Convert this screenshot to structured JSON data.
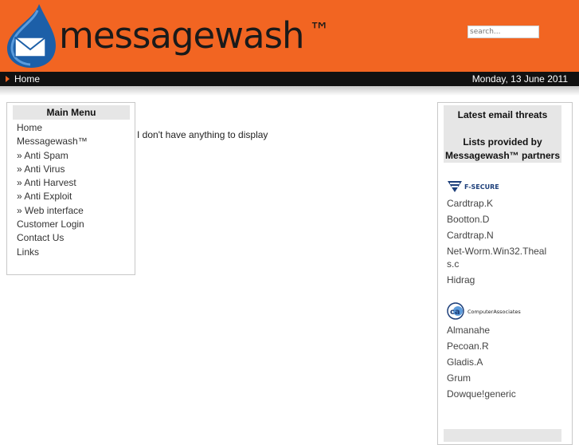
{
  "header": {
    "brand_name": "messagewash",
    "trademark": "™",
    "search_placeholder": "search...",
    "brand_color": "#f26522"
  },
  "navbar": {
    "home_label": "Home",
    "date": "Monday, 13 June 2011"
  },
  "main_menu": {
    "title": "Main Menu",
    "items": [
      {
        "label": "Home"
      },
      {
        "label": "Messagewash™"
      },
      {
        "label": "» Anti Spam"
      },
      {
        "label": "» Anti Virus"
      },
      {
        "label": "» Anti Harvest"
      },
      {
        "label": "» Anti Exploit"
      },
      {
        "label": "» Web interface"
      },
      {
        "label": "Customer Login"
      },
      {
        "label": "Contact Us"
      },
      {
        "label": "Links"
      }
    ]
  },
  "content": {
    "message": "I don't have anything to display"
  },
  "threats": {
    "title": "Latest email threats",
    "subtitle": "Lists provided by Messagewash™ partners",
    "fsecure": {
      "logo_text": "F-SECURE",
      "items": [
        "Cardtrap.K",
        "Bootton.D",
        "Cardtrap.N",
        "Net-Worm.Win32.Theals.c",
        "Hidrag"
      ]
    },
    "ca": {
      "logo_text": "ComputerAssociates",
      "items": [
        "Almanahe",
        "Pecoan.R",
        "Gladis.A",
        "Grum",
        "Dowque!generic"
      ]
    }
  }
}
